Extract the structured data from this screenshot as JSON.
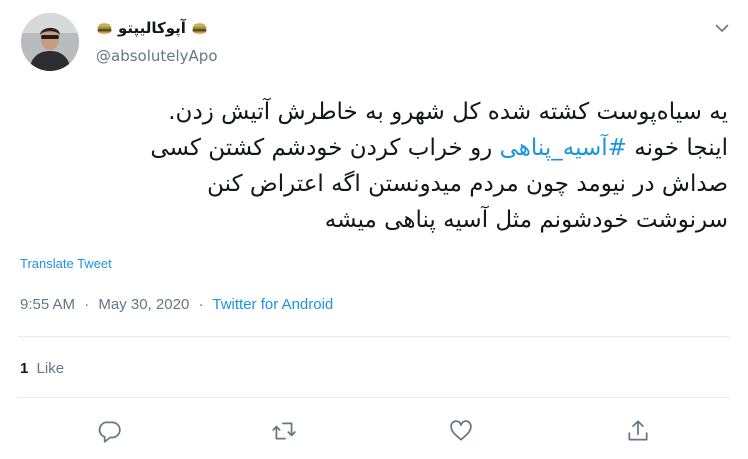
{
  "author": {
    "display_name": "آپوکالیپتو",
    "handle": "@absolutelyApo",
    "name_emoji": "hamburger-icon"
  },
  "tweet": {
    "lines": [
      "یه سیاه‌پوست کشته شده کل شهرو به خاطرش آتیش زدن.",
      {
        "before": "اینجا خونه ",
        "hashtag": "#آسیه_پناهی",
        "after": " رو خراب کردن خودشم کشتن کسی"
      },
      "صداش در نیومد چون مردم میدونستن اگه اعتراض کنن",
      "سرنوشت خودشونم مثل آسیه پناهی میشه"
    ],
    "translate_label": "Translate Tweet"
  },
  "meta": {
    "time": "9:55 AM",
    "date": "May 30, 2020",
    "separator": "·",
    "source": "Twitter for Android"
  },
  "stats": {
    "like_count": "1",
    "like_label": "Like"
  },
  "actions": [
    "reply-icon",
    "retweet-icon",
    "like-icon",
    "share-icon"
  ],
  "colors": {
    "link": "#1b95e0",
    "secondary_text": "#657786",
    "divider": "#e6ecf0",
    "text": "#14171a"
  }
}
